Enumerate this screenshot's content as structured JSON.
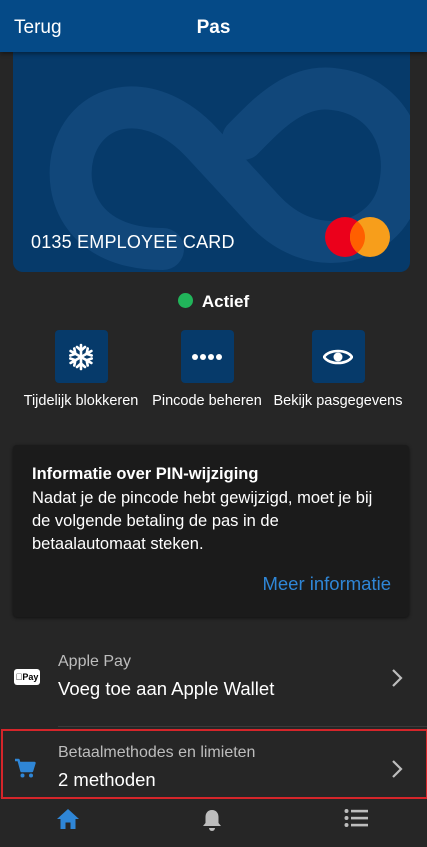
{
  "header": {
    "back_label": "Terug",
    "title": "Pas"
  },
  "card": {
    "label": "0135 EMPLOYEE CARD",
    "brand_logo": "mastercard"
  },
  "status": {
    "label": "Actief",
    "color": "#21b45a"
  },
  "actions": [
    {
      "icon": "snowflake-icon",
      "label": "Tijdelijk blokkeren"
    },
    {
      "icon": "dots-icon",
      "label": "Pincode beheren"
    },
    {
      "icon": "eye-icon",
      "label": "Bekijk pasgegevens"
    }
  ],
  "info": {
    "title": "Informatie over PIN-wijziging",
    "body": "Nadat je de pincode hebt gewijzigd, moet je bij de volgende betaling de pas in de betaalautomaat steken.",
    "link": "Meer informatie"
  },
  "rows": [
    {
      "icon": "apple-pay-icon",
      "icon_text": "Pay",
      "subtitle": "Apple Pay",
      "title": "Voeg toe aan Apple Wallet"
    },
    {
      "icon": "cart-icon",
      "subtitle": "Betaalmethodes en limieten",
      "title": "2 methoden"
    }
  ],
  "tabs": [
    {
      "icon": "home-icon",
      "active": true
    },
    {
      "icon": "bell-icon",
      "active": false
    },
    {
      "icon": "list-icon",
      "active": false
    }
  ],
  "colors": {
    "accent": "#2f86d6",
    "header": "#054a87",
    "card": "#063a6a",
    "highlight": "#d5252a"
  }
}
